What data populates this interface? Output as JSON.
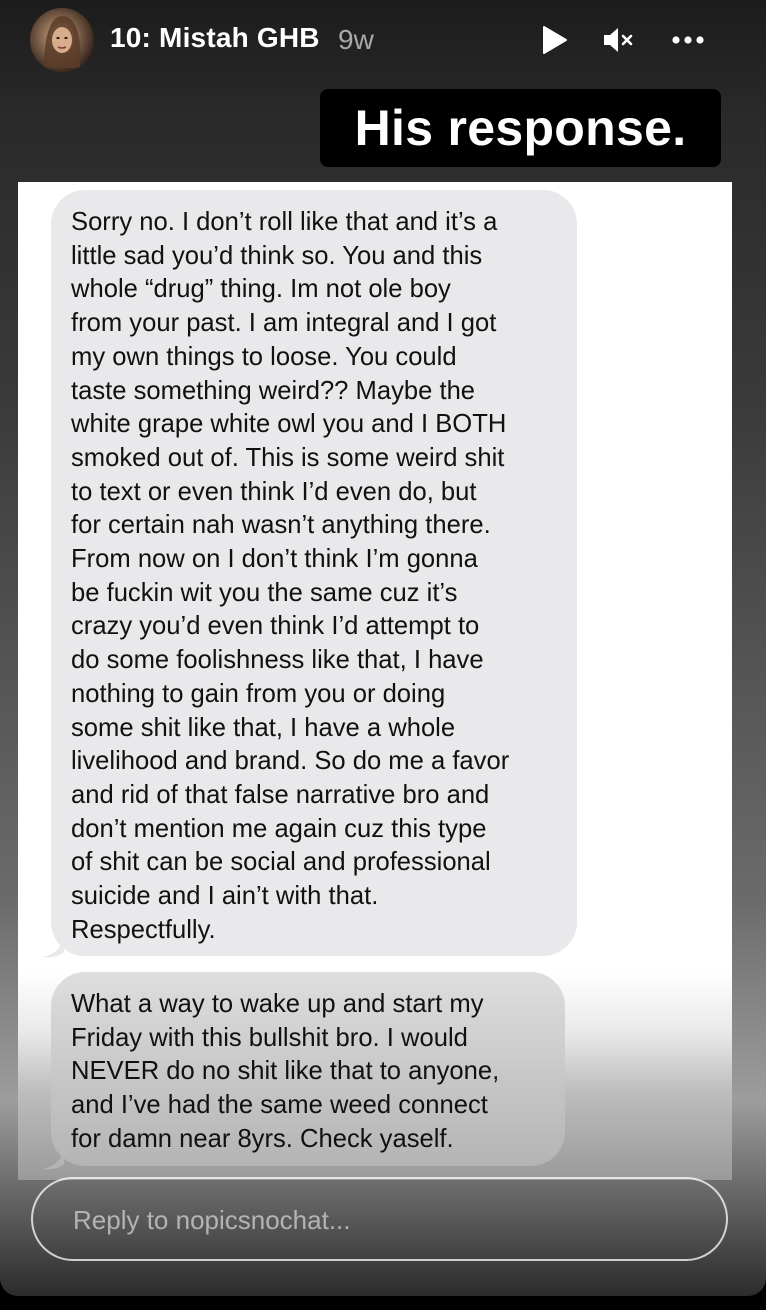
{
  "story": {
    "username": "10: Mistah GHB",
    "time_ago": "9w",
    "caption": "His response.",
    "reply_placeholder": "Reply to nopicsnochat..."
  },
  "controls": {
    "play_icon": "play-icon",
    "mute_icon": "mute-icon",
    "more_icon": "more-icon"
  },
  "messages": [
    {
      "lines": [
        "Sorry no. I don’t roll like that and it’s a",
        "little sad you’d think so. You and this",
        "whole “drug” thing. Im not ole boy",
        "from your past. I am integral and I got",
        "my own things to loose. You could",
        "taste something weird?? Maybe the",
        "white grape white owl you and I BOTH",
        "smoked out of. This is some weird shit",
        "to text or even think I’d even do, but",
        "for certain nah wasn’t anything there.",
        "From now on I don’t think I’m gonna",
        "be fuckin wit you the same cuz it’s",
        "crazy you’d even think I’d attempt to",
        "do some foolishness like that, I have",
        "nothing to gain from you or doing",
        "some shit like that, I have a whole",
        "livelihood and brand. So do me a favor",
        "and rid of that false narrative bro and",
        "don’t mention me again cuz this type",
        "of shit can be social and professional",
        "suicide and I ain’t with that.",
        "Respectfully."
      ]
    },
    {
      "lines": [
        "What a way to wake up and start my",
        "Friday with this bullshit bro. I would",
        "NEVER do no shit like that to anyone,",
        "and I’ve had the same weed connect",
        "for damn near 8yrs. Check yaself."
      ]
    }
  ],
  "colors": {
    "bubble": "#e9e9eb",
    "caption_bg": "#000000",
    "text_light": "#ffffff",
    "time_gray": "#a9a9a9"
  }
}
